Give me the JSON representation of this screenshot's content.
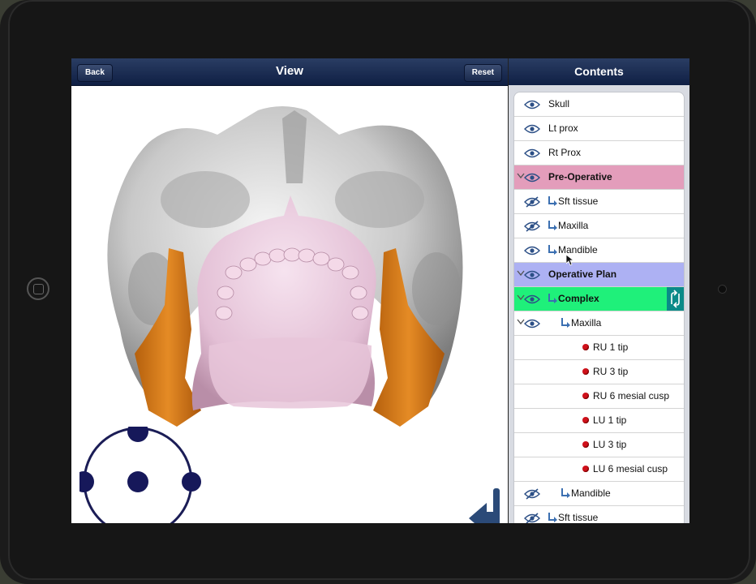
{
  "view": {
    "title": "View",
    "back_label": "Back",
    "reset_label": "Reset"
  },
  "contents": {
    "title": "Contents",
    "items": [
      {
        "label": "Skull",
        "visible": true
      },
      {
        "label": "Lt prox",
        "visible": true
      },
      {
        "label": "Rt Prox",
        "visible": true
      },
      {
        "label": "Pre-Operative",
        "visible": true,
        "group": true,
        "color": "#e39dbb"
      },
      {
        "label": "Sft tissue",
        "visible": false
      },
      {
        "label": "Maxilla",
        "visible": false
      },
      {
        "label": "Mandible",
        "visible": true
      },
      {
        "label": "Operative Plan",
        "visible": true,
        "group": true,
        "color": "#adb1f3"
      },
      {
        "label": "Complex",
        "visible": true,
        "group": true,
        "selected": true,
        "color": "#1ff07a"
      },
      {
        "label": "Maxilla",
        "visible": true
      },
      {
        "label": "RU 1 tip",
        "landmark": true
      },
      {
        "label": "RU 3 tip",
        "landmark": true
      },
      {
        "label": "RU 6 mesial cusp",
        "landmark": true
      },
      {
        "label": "LU 1 tip",
        "landmark": true
      },
      {
        "label": "LU 3 tip",
        "landmark": true
      },
      {
        "label": "LU 6 mesial cusp",
        "landmark": true
      },
      {
        "label": "Mandible",
        "visible": false
      },
      {
        "label": "Sft tissue",
        "visible": false
      }
    ]
  },
  "colors": {
    "skull": "#d7d7d7",
    "soft_tissue": "#e9c9dc",
    "ramus": "#d97b1a",
    "landmark_dot": "#d0111b",
    "navbar": "#15264b"
  }
}
